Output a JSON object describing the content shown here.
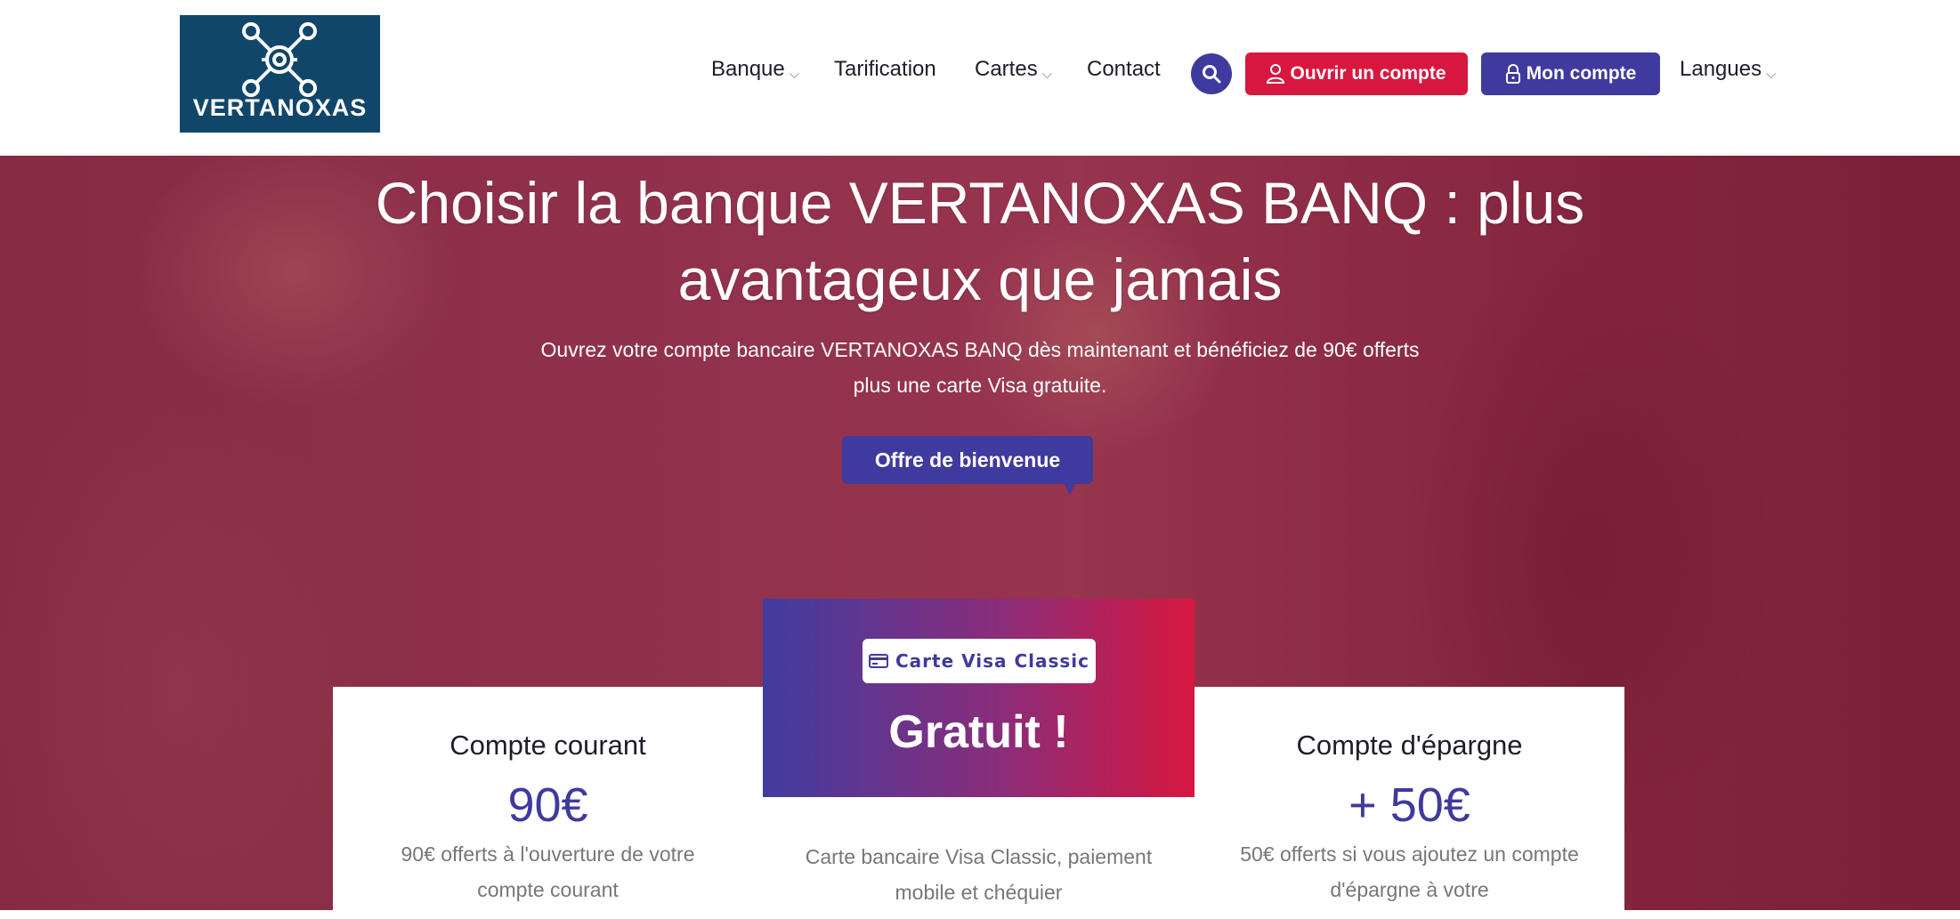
{
  "header": {
    "logo_text": "VERTANOXAS",
    "nav": [
      {
        "label": "Banque",
        "has_dropdown": true
      },
      {
        "label": "Tarification",
        "has_dropdown": false
      },
      {
        "label": "Cartes",
        "has_dropdown": true
      },
      {
        "label": "Contact",
        "has_dropdown": false
      }
    ],
    "open_account_label": "Ouvrir un compte",
    "my_account_label": "Mon compte",
    "languages_label": "Langues",
    "caret_glyph": "⌵"
  },
  "hero": {
    "title": "Choisir la banque VERTANOXAS BANQ : plus avantageux que jamais",
    "subtitle": "Ouvrez votre compte bancaire VERTANOXAS BANQ dès maintenant et bénéficiez de 90€ offerts plus une carte Visa gratuite.",
    "cta_label": "Offre de bienvenue"
  },
  "offers": {
    "current": {
      "title": "Compte courant",
      "price": "90€",
      "description": "90€ offerts à l'ouverture de votre compte courant"
    },
    "card": {
      "tag": "Carte Visa Classic",
      "headline": "Gratuit !",
      "description": "Carte bancaire Visa Classic, paiement mobile et chéquier"
    },
    "savings": {
      "title": "Compte d'épargne",
      "price": "+ 50€",
      "description": "50€ offerts si vous ajoutez un compte d'épargne à votre"
    }
  },
  "colors": {
    "brand_navy": "#11466b",
    "accent_purple": "#3f3a9d",
    "accent_red": "#d7173f",
    "hero_overlay": "#911c3e"
  },
  "icons": [
    "network-logo-icon",
    "search-icon",
    "user-icon",
    "lock-icon",
    "credit-card-icon",
    "chevron-down-icon"
  ]
}
